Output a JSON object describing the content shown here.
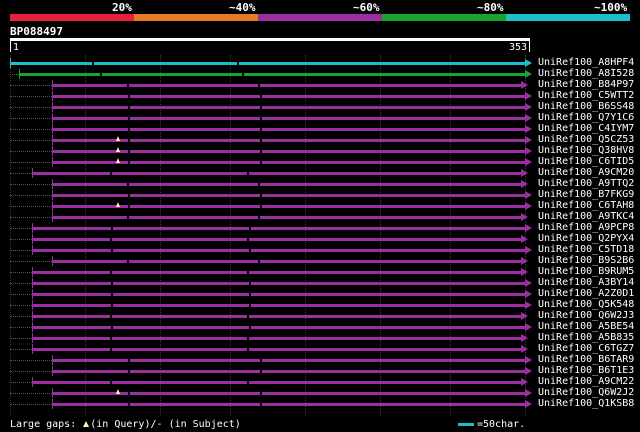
{
  "legend": {
    "labels": [
      "20%",
      "~40%",
      "~60%",
      "~80%",
      "~100%"
    ],
    "colors": [
      "#e8203a",
      "#ea7a22",
      "#9b2fa0",
      "#1ba330",
      "#1ec0c8"
    ]
  },
  "query": {
    "id": "BP088497",
    "start_label": "1",
    "end_label": "353",
    "length": 353
  },
  "footer": {
    "large_gaps_prefix": "Large gaps:",
    "in_query": "(in Query)/",
    "subject_marker": "-",
    "in_subject": "(in Subject)",
    "scale_label": "=50char.",
    "scale_color": "#1ec0c8"
  },
  "hits": [
    {
      "name": "UniRef100_A8HPF4",
      "color": "#1ec0c8",
      "start": 1,
      "end": 353,
      "gap_query": false
    },
    {
      "name": "UniRef100_A8I528",
      "color": "#1ba330",
      "start": 7,
      "end": 353,
      "gap_query": false
    },
    {
      "name": "UniRef100_B84P97",
      "color": "#9b2fa0",
      "start": 30,
      "end": 350,
      "gap_query": false
    },
    {
      "name": "UniRef100_C5WTT2",
      "color": "#9b2fa0",
      "start": 30,
      "end": 353,
      "gap_query": false
    },
    {
      "name": "UniRef100_B6SS48",
      "color": "#9b2fa0",
      "start": 30,
      "end": 353,
      "gap_query": false
    },
    {
      "name": "UniRef100_Q7Y1C6",
      "color": "#9b2fa0",
      "start": 30,
      "end": 353,
      "gap_query": false
    },
    {
      "name": "UniRef100_C4IYM7",
      "color": "#9b2fa0",
      "start": 30,
      "end": 353,
      "gap_query": false
    },
    {
      "name": "UniRef100_Q5CZ53",
      "color": "#9b2fa0",
      "start": 30,
      "end": 353,
      "gap_query": true
    },
    {
      "name": "UniRef100_Q38HV8",
      "color": "#9b2fa0",
      "start": 30,
      "end": 353,
      "gap_query": true
    },
    {
      "name": "UniRef100_C6TID5",
      "color": "#9b2fa0",
      "start": 30,
      "end": 353,
      "gap_query": true
    },
    {
      "name": "UniRef100_A9CM20",
      "color": "#9b2fa0",
      "start": 16,
      "end": 350,
      "gap_query": false
    },
    {
      "name": "UniRef100_A9TTQ2",
      "color": "#9b2fa0",
      "start": 30,
      "end": 350,
      "gap_query": false
    },
    {
      "name": "UniRef100_B7FKG9",
      "color": "#9b2fa0",
      "start": 30,
      "end": 353,
      "gap_query": false
    },
    {
      "name": "UniRef100_C6TAH8",
      "color": "#9b2fa0",
      "start": 30,
      "end": 353,
      "gap_query": true
    },
    {
      "name": "UniRef100_A9TKC4",
      "color": "#9b2fa0",
      "start": 30,
      "end": 350,
      "gap_query": false
    },
    {
      "name": "UniRef100_A9PCP8",
      "color": "#9b2fa0",
      "start": 16,
      "end": 353,
      "gap_query": false
    },
    {
      "name": "UniRef100_Q2PYX4",
      "color": "#9b2fa0",
      "start": 16,
      "end": 350,
      "gap_query": false
    },
    {
      "name": "UniRef100_C5TD18",
      "color": "#9b2fa0",
      "start": 16,
      "end": 353,
      "gap_query": false
    },
    {
      "name": "UniRef100_B9S2B6",
      "color": "#9b2fa0",
      "start": 30,
      "end": 350,
      "gap_query": false
    },
    {
      "name": "UniRef100_B9RUM5",
      "color": "#9b2fa0",
      "start": 16,
      "end": 350,
      "gap_query": false
    },
    {
      "name": "UniRef100_A3BY14",
      "color": "#9b2fa0",
      "start": 16,
      "end": 353,
      "gap_query": false
    },
    {
      "name": "UniRef100_A2Z0D1",
      "color": "#9b2fa0",
      "start": 16,
      "end": 353,
      "gap_query": false
    },
    {
      "name": "UniRef100_Q5K548",
      "color": "#9b2fa0",
      "start": 16,
      "end": 353,
      "gap_query": false
    },
    {
      "name": "UniRef100_Q6W2J3",
      "color": "#9b2fa0",
      "start": 16,
      "end": 350,
      "gap_query": false
    },
    {
      "name": "UniRef100_A5BE54",
      "color": "#9b2fa0",
      "start": 16,
      "end": 353,
      "gap_query": false
    },
    {
      "name": "UniRef100_A5B835",
      "color": "#9b2fa0",
      "start": 16,
      "end": 350,
      "gap_query": false
    },
    {
      "name": "UniRef100_C6TGZ7",
      "color": "#9b2fa0",
      "start": 16,
      "end": 350,
      "gap_query": false
    },
    {
      "name": "UniRef100_B6TAR9",
      "color": "#9b2fa0",
      "start": 30,
      "end": 353,
      "gap_query": false
    },
    {
      "name": "UniRef100_B6T1E3",
      "color": "#9b2fa0",
      "start": 30,
      "end": 353,
      "gap_query": false
    },
    {
      "name": "UniRef100_A9CM22",
      "color": "#9b2fa0",
      "start": 16,
      "end": 350,
      "gap_query": false
    },
    {
      "name": "UniRef100_Q6W2J2",
      "color": "#9b2fa0",
      "start": 30,
      "end": 353,
      "gap_query": true
    },
    {
      "name": "UniRef100_Q1KSB8",
      "color": "#9b2fa0",
      "start": 30,
      "end": 353,
      "gap_query": false
    }
  ]
}
